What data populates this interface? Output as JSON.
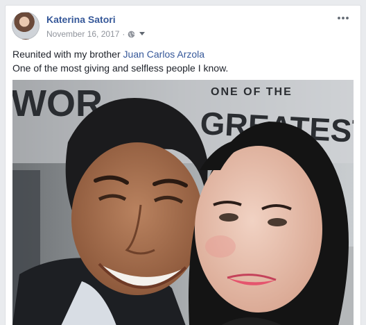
{
  "post": {
    "author": "Katerina Satori",
    "date": "November 16, 2017",
    "separator": "·",
    "privacy_icon": "globe-icon",
    "audience_dropdown_icon": "caret-down-icon",
    "more_icon": "more-horizontal-icon",
    "text_line1_prefix": "Reunited with my brother ",
    "mentioned_name": "Juan Carlos Arzola",
    "text_line2": "One of the most giving and selfless people I know.",
    "photo_banner_text_left": "WOR",
    "photo_banner_text_small": "ONE OF THE",
    "photo_banner_text_right": "GREATEST",
    "colors": {
      "link": "#365899",
      "meta": "#90949c",
      "text": "#1d2129",
      "page_bg": "#e9ebee"
    }
  }
}
